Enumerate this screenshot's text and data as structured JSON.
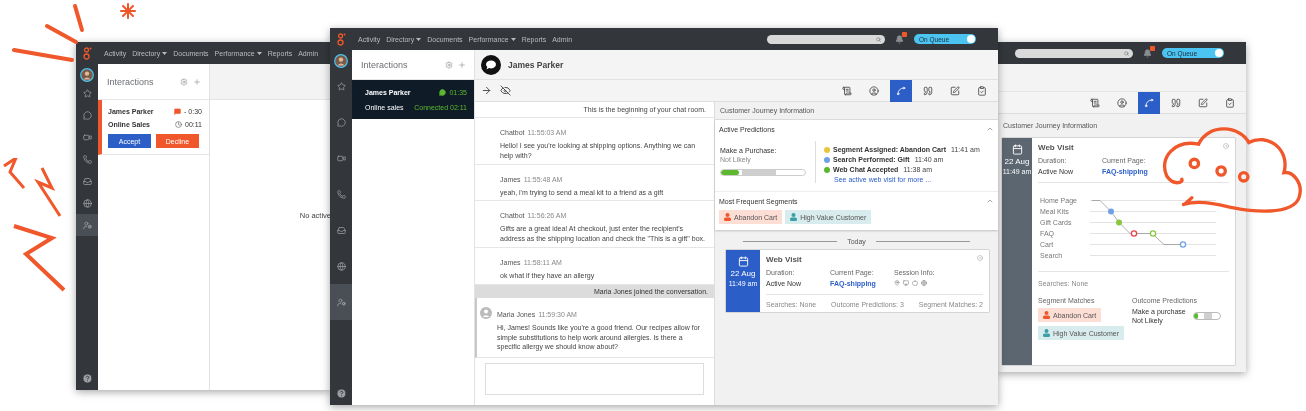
{
  "left_window": {
    "nav": [
      {
        "label": "Activity",
        "dropdown": false
      },
      {
        "label": "Directory",
        "dropdown": true
      },
      {
        "label": "Documents",
        "dropdown": false
      },
      {
        "label": "Performance",
        "dropdown": true
      },
      {
        "label": "Reports",
        "dropdown": false
      },
      {
        "label": "Admin",
        "dropdown": false
      }
    ],
    "sidebar": [
      {
        "kind": "star",
        "selected": false
      },
      {
        "kind": "chat",
        "selected": false
      },
      {
        "kind": "video",
        "selected": false
      },
      {
        "kind": "phone",
        "selected": false
      },
      {
        "kind": "inbox",
        "selected": false
      },
      {
        "kind": "globe",
        "selected": false
      },
      {
        "kind": "agent",
        "selected": true
      }
    ],
    "interactions": {
      "title": "Interactions",
      "items": [
        {
          "name": "James Parker",
          "wait": "- 0:30",
          "queue": "Online Sales",
          "timer": "00:11",
          "alerting": true,
          "actions": [
            {
              "label": "Accept",
              "kind": "accept"
            },
            {
              "label": "Decline",
              "kind": "decline"
            }
          ]
        }
      ]
    },
    "empty_message": "No active"
  },
  "front_window": {
    "nav": [
      {
        "label": "Activity",
        "dropdown": false
      },
      {
        "label": "Directory",
        "dropdown": true
      },
      {
        "label": "Documents",
        "dropdown": false
      },
      {
        "label": "Performance",
        "dropdown": true
      },
      {
        "label": "Reports",
        "dropdown": false
      },
      {
        "label": "Admin",
        "dropdown": false
      }
    ],
    "notification": true,
    "status": {
      "label": "On Queue",
      "on": true
    },
    "sidebar": [
      {
        "kind": "star",
        "selected": false
      },
      {
        "kind": "chat",
        "selected": false
      },
      {
        "kind": "video",
        "selected": false
      },
      {
        "kind": "phone",
        "selected": false
      },
      {
        "kind": "inbox",
        "selected": false
      },
      {
        "kind": "globe",
        "selected": false
      },
      {
        "kind": "agent",
        "selected": true
      }
    ],
    "interactions": {
      "title": "Interactions",
      "items": [
        {
          "name": "James Parker",
          "timer": "01:35",
          "queue": "Online sales",
          "status": "Connected 02:11",
          "selected": true
        }
      ]
    },
    "conversation": {
      "title": "James Parker",
      "toolbar": [
        {
          "kind": "script",
          "selected": false
        },
        {
          "kind": "person",
          "selected": false
        },
        {
          "kind": "journey",
          "selected": true
        },
        {
          "kind": "quote",
          "selected": false
        },
        {
          "kind": "edit",
          "selected": false
        },
        {
          "kind": "clipboard",
          "selected": false
        }
      ]
    },
    "chat": {
      "intro": "This is the beginning of your chat room.",
      "messages": [
        {
          "kind": "message",
          "author": "Chatbot",
          "time": "11:55:03 AM",
          "text": "Hello! I see you're looking at shipping options. Anything we can help with?"
        },
        {
          "kind": "message",
          "author": "James",
          "time": "11:55:48 AM",
          "text": "yeah, i'm trying to send a meal kit to a friend as a gift"
        },
        {
          "kind": "message",
          "author": "Chatbot",
          "time": "11:56:26 AM",
          "text": "Gifts are a great idea! At checkout, just enter the recipient's address as the shipping location and check the \"This is a gift\" box."
        },
        {
          "kind": "message",
          "author": "James",
          "time": "11:58:11 AM",
          "text": "ok what if they have an allergy"
        },
        {
          "kind": "notice",
          "text": "Maria Jones joined the conversation."
        },
        {
          "kind": "agent",
          "author": "Maria Jones",
          "time": "11:59:30 AM",
          "text": "Hi, James! Sounds like you're a good friend. Our recipes allow for simple substitutions to help work around allergies. Is there a specific allergy we should know about?"
        }
      ]
    },
    "journey": {
      "title": "Customer Journey Information",
      "predictions": {
        "title": "Active Predictions",
        "expanded": true,
        "label": "Make a Purchase:",
        "value": "Not Likely",
        "level": 0.22,
        "events": [
          {
            "text": "Segment Assigned: Abandon Cart",
            "time": "11:41 am",
            "color": "#e8c53a"
          },
          {
            "text": "Search Performed: Gift",
            "time": "11:40 am",
            "color": "#6fa0e8"
          },
          {
            "text": "Web Chat Accepted",
            "time": "11:38 am",
            "color": "#5cb82f"
          }
        ],
        "link": "See active web visit for more ..."
      },
      "segments": {
        "title": "Most Frequent Segments",
        "expanded": true,
        "items": [
          {
            "label": "Abandon Cart",
            "color": "#f0582b"
          },
          {
            "label": "High Value Customer",
            "color": "#3b9fa6"
          }
        ]
      },
      "day": "Today",
      "visit": {
        "title": "Web Visit",
        "date": "22 Aug",
        "time": "11:49 am",
        "fields": [
          {
            "label": "Duration:",
            "value": "Active Now",
            "kind": "text"
          },
          {
            "label": "Current Page:",
            "value": "FAQ-shipping",
            "kind": "link"
          },
          {
            "label": "Session Info:",
            "kind": "icons"
          }
        ],
        "footer": [
          "Searches: None",
          "Outcome Predictions: 3",
          "Segment Matches: 2"
        ]
      }
    }
  },
  "right_window": {
    "notification": true,
    "status": {
      "label": "On Queue",
      "on": true
    },
    "toolbar": [
      {
        "kind": "script",
        "selected": false
      },
      {
        "kind": "person",
        "selected": false
      },
      {
        "kind": "journey",
        "selected": true
      },
      {
        "kind": "quote",
        "selected": false
      },
      {
        "kind": "edit",
        "selected": false
      },
      {
        "kind": "clipboard",
        "selected": false
      }
    ],
    "journey_title": "Customer Journey Information",
    "visit": {
      "title": "Web Visit",
      "date": "22 Aug",
      "time": "11:49 am",
      "fields": [
        {
          "label": "Duration:",
          "value": "Active Now",
          "kind": "text"
        },
        {
          "label": "Current Page:",
          "value": "FAQ-shipping",
          "kind": "link"
        }
      ],
      "pages": [
        "Home Page",
        "Meal Kits",
        "Gift Cards",
        "FAQ",
        "Cart",
        "Search"
      ],
      "searches": "Searches: None",
      "segments_title": "Segment Matches",
      "segments": [
        {
          "label": "Abandon Cart",
          "color": "#f0582b"
        },
        {
          "label": "High Value Customer",
          "color": "#3b9fa6"
        }
      ],
      "outcomes_title": "Outcome Predictions",
      "outcome": {
        "label": "Make a purchase",
        "value": "Not Likely",
        "level": 0.15
      }
    }
  }
}
